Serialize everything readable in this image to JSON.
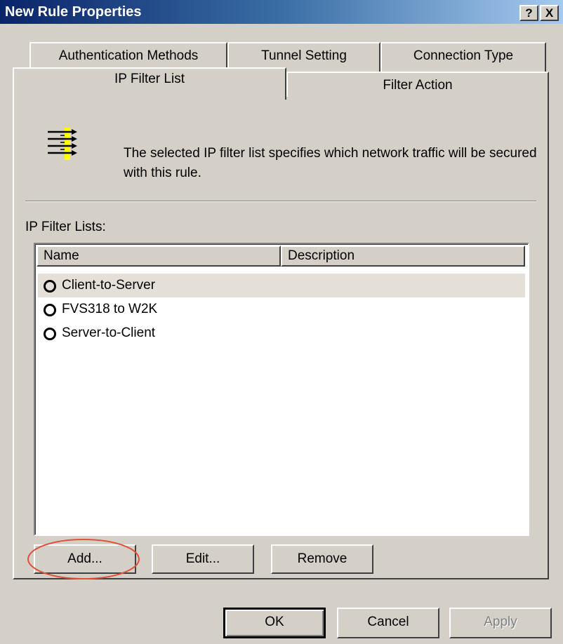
{
  "window": {
    "title": "New Rule Properties",
    "help_button": "?",
    "close_button": "X"
  },
  "tabs": {
    "back_row": [
      "Authentication Methods",
      "Tunnel Setting",
      "Connection Type"
    ],
    "front_row": [
      "IP Filter List",
      "Filter Action"
    ],
    "active": "IP Filter List"
  },
  "panel": {
    "icon": "ip-filter-list-icon",
    "description": "The selected IP filter list specifies which network traffic will be secured with this rule.",
    "list_label": "IP Filter Lists:",
    "columns": [
      "Name",
      "Description"
    ],
    "items": [
      {
        "name": "Client-to-Server",
        "description": "",
        "selected": true
      },
      {
        "name": "FVS318 to W2K",
        "description": "",
        "selected": false
      },
      {
        "name": "Server-to-Client",
        "description": "",
        "selected": false
      }
    ],
    "buttons": {
      "add": "Add...",
      "edit": "Edit...",
      "remove": "Remove"
    }
  },
  "footer": {
    "ok": "OK",
    "cancel": "Cancel",
    "apply": "Apply"
  },
  "colors": {
    "titlebar_start": "#0a246a",
    "titlebar_end": "#a6caf0",
    "dialog_face": "#d4d0c8",
    "annotation_ellipse": "#e0503a",
    "icon_highlight": "#ffff00"
  }
}
